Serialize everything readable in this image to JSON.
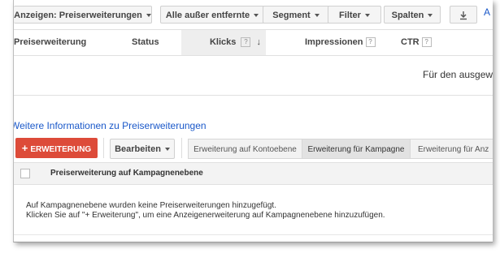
{
  "toolbar": {
    "show_label": "Anzeigen: Preiserweiterungen",
    "filter_all_label": "Alle außer entfernte",
    "segment_label": "Segment",
    "filter_label": "Filter",
    "columns_label": "Spalten",
    "download_icon": "download-icon",
    "cut_text": "A"
  },
  "table": {
    "headers": [
      "Preiserweiterung",
      "Status",
      "Klicks",
      "Impressionen",
      "CTR"
    ],
    "help_mark": "?",
    "empty_text_cut": "Für den ausgew"
  },
  "info_link": "Weitere Informationen zu Preiserweiterungen",
  "actions": {
    "add_label": "ERWEITERUNG",
    "add_plus": "+",
    "edit_label": "Bearbeiten",
    "tabs": [
      "Erweiterung auf Kontoebene",
      "Erweiterung für Kampagne",
      "Erweiterung für Anz"
    ],
    "selected_tab": 1
  },
  "campaign_table": {
    "header": "Preiserweiterung auf Kampagnenebene",
    "empty_line1": "Auf Kampagnenebene wurden keine Preiserweiterungen hinzugefügt.",
    "empty_line2": "Klicken Sie auf \"+ Erweiterung\", um eine Anzeigenerweiterung auf Kampagnenebene hinzuzufügen."
  },
  "colors": {
    "red": "#dd4b39",
    "link": "#1a58c9"
  }
}
